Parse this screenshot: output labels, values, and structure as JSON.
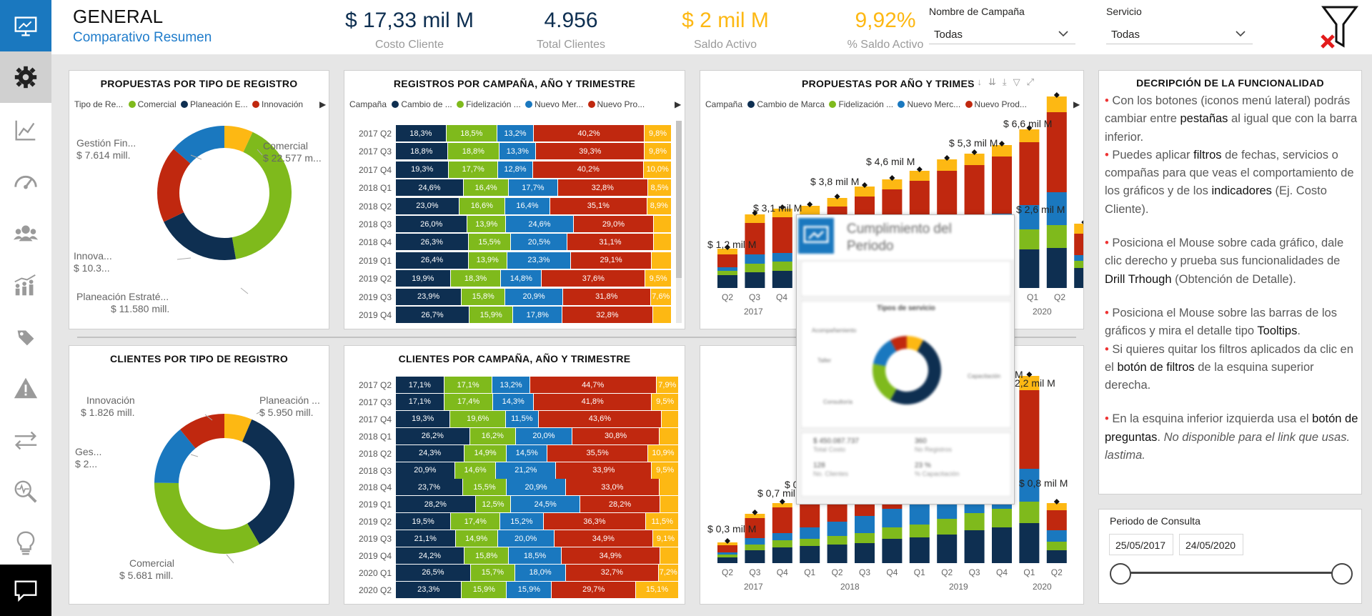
{
  "colors": {
    "navy": "#0e2f51",
    "green": "#7fba1c",
    "blue": "#1a78bf",
    "red": "#c0280f",
    "gold": "#fdb813",
    "accent": "#1f7ccb"
  },
  "nav": {
    "items": [
      {
        "icon": "presentation-icon",
        "active": true
      },
      {
        "icon": "gear-icon"
      },
      {
        "icon": "line-chart-icon"
      },
      {
        "icon": "gauge-icon"
      },
      {
        "icon": "customers-icon"
      },
      {
        "icon": "growth-people-icon"
      },
      {
        "icon": "tags-icon"
      },
      {
        "icon": "warning-icon"
      },
      {
        "icon": "transfer-arrows-icon"
      },
      {
        "icon": "search-pulse-icon"
      },
      {
        "icon": "lightbulb-icon"
      }
    ],
    "bottom_icon": "chat-question-icon"
  },
  "header": {
    "title": "GENERAL",
    "subtitle": "Comparativo Resumen",
    "kpis": [
      {
        "value": "$ 17,33 mil M",
        "label": "Costo Cliente",
        "color": "#0e2f51"
      },
      {
        "value": "4.956",
        "label": "Total Clientes",
        "color": "#0e2f51"
      },
      {
        "value": "$ 2 mil M",
        "label": "Saldo Activo",
        "color": "#fdb813"
      },
      {
        "value": "9,92%",
        "label": "% Saldo Activo",
        "color": "#fdb813"
      }
    ],
    "filters": [
      {
        "label": "Nombre de Campaña",
        "value": "Todas"
      },
      {
        "label": "Servicio",
        "value": "Todas"
      }
    ],
    "clear_filters_icon": "clear-filter-icon"
  },
  "donut1": {
    "title": "PROPUESTAS POR TIPO DE REGISTRO",
    "legend_header": "Tipo de Re...",
    "legend": [
      {
        "name": "Comercial",
        "color": "#7fba1c"
      },
      {
        "name": "Planeación E...",
        "color": "#0e2f51"
      },
      {
        "name": "Innovación",
        "color": "#c0280f"
      }
    ],
    "labels": [
      {
        "l1": "Comercial",
        "l2": "$ 22.577 m..."
      },
      {
        "l1": "Gestión Fin...",
        "l2": "$ 7.614 mill."
      },
      {
        "l1": "Innova...",
        "l2": "$ 10.3..."
      },
      {
        "l1": "Planeación Estraté...",
        "l2": "$ 11.580 mill."
      }
    ]
  },
  "donut2": {
    "title": "CLIENTES POR TIPO DE REGISTRO",
    "labels": [
      {
        "l1": "Planeación ...",
        "l2": "$ 5.950 mill."
      },
      {
        "l1": "Innovación",
        "l2": "$ 1.826 mill."
      },
      {
        "l1": "Ges...",
        "l2": "$ 2..."
      },
      {
        "l1": "Comercial",
        "l2": "$ 5.681 mill."
      }
    ]
  },
  "table1": {
    "title": "REGISTROS POR CAMPAÑA, AÑO Y TRIMESTRE",
    "legend_header": "Campaña",
    "legend": [
      {
        "name": "Cambio de ...",
        "color": "#0e2f51"
      },
      {
        "name": "Fidelización ...",
        "color": "#7fba1c"
      },
      {
        "name": "Nuevo Mer...",
        "color": "#1a78bf"
      },
      {
        "name": "Nuevo Pro...",
        "color": "#c0280f"
      }
    ],
    "rows": [
      {
        "cat": "2017 Q2",
        "v": [
          "18,3%",
          "18,5%",
          "13,2%",
          "40,2%",
          "9,8%"
        ]
      },
      {
        "cat": "2017 Q3",
        "v": [
          "18,8%",
          "18,8%",
          "13,3%",
          "39,3%",
          "9,8%"
        ]
      },
      {
        "cat": "2017 Q4",
        "v": [
          "19,3%",
          "17,7%",
          "12,8%",
          "40,2%",
          "10,0%"
        ]
      },
      {
        "cat": "2018 Q1",
        "v": [
          "24,6%",
          "16,4%",
          "17,7%",
          "32,8%",
          "8,5%"
        ]
      },
      {
        "cat": "2018 Q2",
        "v": [
          "23,0%",
          "16,6%",
          "16,4%",
          "35,1%",
          "8,9%"
        ]
      },
      {
        "cat": "2018 Q3",
        "v": [
          "26,0%",
          "13,9%",
          "24,6%",
          "29,0%",
          ""
        ]
      },
      {
        "cat": "2018 Q4",
        "v": [
          "26,3%",
          "15,5%",
          "20,5%",
          "31,1%",
          ""
        ]
      },
      {
        "cat": "2019 Q1",
        "v": [
          "26,4%",
          "13,9%",
          "23,3%",
          "29,1%",
          ""
        ]
      },
      {
        "cat": "2019 Q2",
        "v": [
          "19,9%",
          "18,3%",
          "14,8%",
          "37,6%",
          "9,5%"
        ]
      },
      {
        "cat": "2019 Q3",
        "v": [
          "23,9%",
          "15,8%",
          "20,9%",
          "31,8%",
          "7,6%"
        ]
      },
      {
        "cat": "2019 Q4",
        "v": [
          "26,7%",
          "15,9%",
          "17,8%",
          "32,8%",
          ""
        ]
      }
    ]
  },
  "table2": {
    "title": "CLIENTES POR CAMPAÑA, AÑO Y TRIMESTRE",
    "rows": [
      {
        "cat": "2017 Q2",
        "v": [
          "17,1%",
          "17,1%",
          "13,2%",
          "44,7%",
          "7,9%"
        ]
      },
      {
        "cat": "2017 Q3",
        "v": [
          "17,1%",
          "17,4%",
          "14,3%",
          "41,8%",
          "9,5%"
        ]
      },
      {
        "cat": "2017 Q4",
        "v": [
          "19,3%",
          "19,6%",
          "11,5%",
          "43,6%",
          ""
        ]
      },
      {
        "cat": "2018 Q1",
        "v": [
          "26,2%",
          "16,2%",
          "20,0%",
          "30,8%",
          ""
        ]
      },
      {
        "cat": "2018 Q2",
        "v": [
          "24,3%",
          "14,9%",
          "14,5%",
          "35,5%",
          "10,9%"
        ]
      },
      {
        "cat": "2018 Q3",
        "v": [
          "20,9%",
          "14,6%",
          "21,2%",
          "33,9%",
          "9,5%"
        ]
      },
      {
        "cat": "2018 Q4",
        "v": [
          "23,7%",
          "15,5%",
          "20,9%",
          "33,0%",
          ""
        ]
      },
      {
        "cat": "2019 Q1",
        "v": [
          "28,2%",
          "12,5%",
          "24,5%",
          "28,2%",
          ""
        ]
      },
      {
        "cat": "2019 Q2",
        "v": [
          "19,5%",
          "17,4%",
          "15,2%",
          "36,3%",
          "11,5%"
        ]
      },
      {
        "cat": "2019 Q3",
        "v": [
          "21,1%",
          "14,9%",
          "20,0%",
          "34,9%",
          "9,1%"
        ]
      },
      {
        "cat": "2019 Q4",
        "v": [
          "24,2%",
          "15,8%",
          "18,5%",
          "34,9%",
          ""
        ]
      },
      {
        "cat": "2020 Q1",
        "v": [
          "26,5%",
          "15,7%",
          "18,0%",
          "32,7%",
          "7,2%"
        ]
      },
      {
        "cat": "2020 Q2",
        "v": [
          "23,3%",
          "15,9%",
          "15,9%",
          "29,7%",
          "15,1%"
        ]
      }
    ]
  },
  "column1": {
    "title": "PROPUESTAS POR AÑO Y TRIMES",
    "legend_header": "Campaña",
    "legend": [
      {
        "name": "Cambio de Marca",
        "color": "#0e2f51"
      },
      {
        "name": "Fidelización ...",
        "color": "#7fba1c"
      },
      {
        "name": "Nuevo Merc...",
        "color": "#1a78bf"
      },
      {
        "name": "Nuevo Prod...",
        "color": "#c0280f"
      }
    ],
    "annotations": [
      "$ 1,2 mil M",
      "$ 3,1 mil M",
      "$ 3,8 mil M",
      "$ 4,6 mil M",
      "$ 5,3 mil M",
      "$ 6,6 mil M",
      "$ 2,6 mil M"
    ],
    "quarters": [
      "Q2",
      "Q3",
      "Q4",
      "Q1",
      "Q2"
    ],
    "years": [
      "2017",
      "2020"
    ]
  },
  "column2": {
    "annotations": [
      "$ 0,3 mil M",
      "$ 0,7 mil M",
      "$ 0",
      "M",
      "2,2 mil M",
      "$ 0,8 mil M"
    ],
    "quarters": [
      "Q2",
      "Q3",
      "Q4",
      "Q1",
      "Q2",
      "Q3",
      "Q4",
      "Q1",
      "Q2",
      "Q3",
      "Q4",
      "Q1",
      "Q2"
    ],
    "years": [
      "2017",
      "2018",
      "2019",
      "2020"
    ]
  },
  "tooltip": {
    "title": "Cumplimiento del Periodo",
    "inner_title": "Tipos de servicio",
    "small_labels": [
      "Acompañamiento",
      "Taller",
      "Consultoría",
      "Capacitación"
    ],
    "stats": [
      "$ 450.087.737",
      "Total Costo",
      "360",
      "No Registros",
      "128",
      "No. Clientes",
      "23 %",
      "% Capacitación"
    ]
  },
  "description": {
    "title": "DECRIPCIÓN DE LA FUNCIONALIDAD",
    "p1a": "Con los botones (iconos menú lateral) podrás cambiar entre ",
    "p1b": "pestañas",
    "p1c": " al igual que con la barra inferior.",
    "p2a": "Puedes aplicar ",
    "p2b": "filtros",
    "p2c": " de fechas, servicios o compañas para que veas el comportamiento de los gráficos y de los ",
    "p2d": "indicadores",
    "p2e": " (Ej. Costo Cliente).",
    "p3a": "Posiciona el Mouse sobre cada gráfico, dale clic derecho y prueba sus funcionalidades de ",
    "p3b": "Drill Trhough",
    "p3c": " (Obtención de Detalle).",
    "p4a": "Posiciona el Mouse sobre las barras de los gráficos y mira el detalle tipo ",
    "p4b": "Tooltips",
    "p4c": ".",
    "p5a": "Si quieres quitar los filtros aplicados da clic en el ",
    "p5b": "botón de filtros",
    "p5c": " de la esquina superior derecha.",
    "p6a": "En la esquina inferior izquierda usa el ",
    "p6b": "botón de preguntas",
    "p6c": ". ",
    "p6d": "No disponible para el link que usas. lastima."
  },
  "slicer": {
    "title": "Periodo de Consulta",
    "start": "25/05/2017",
    "end": "24/05/2020"
  }
}
